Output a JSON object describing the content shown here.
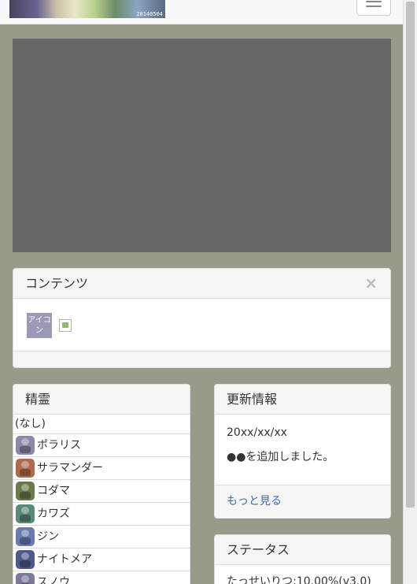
{
  "banner": {
    "stamp": "20140504"
  },
  "contents": {
    "title": "コンテンツ",
    "close": "×",
    "icon_label": "アイコン"
  },
  "spirits": {
    "title": "精霊",
    "none": "(なし)",
    "items": [
      {
        "name": "ポラリス",
        "color": "#8a8aa8"
      },
      {
        "name": "サラマンダー",
        "color": "#b06a4a"
      },
      {
        "name": "コダマ",
        "color": "#6a7a4a"
      },
      {
        "name": "カワズ",
        "color": "#5a8a7a"
      },
      {
        "name": "ジン",
        "color": "#6a7ab0"
      },
      {
        "name": "ナイトメア",
        "color": "#4a5a8a"
      },
      {
        "name": "スノウ",
        "color": "#7a7a9a"
      }
    ]
  },
  "news": {
    "title": "更新情報",
    "date": "20xx/xx/xx",
    "message": "●●を追加しました。",
    "more_link": "もっと見る"
  },
  "status": {
    "title": "ステータス",
    "text": "たっせいりつ:10.00%(v3.0)"
  },
  "colors": {
    "page_background": "#9a9a8a",
    "video_placeholder": "#666666",
    "link": "#3a6db0"
  }
}
